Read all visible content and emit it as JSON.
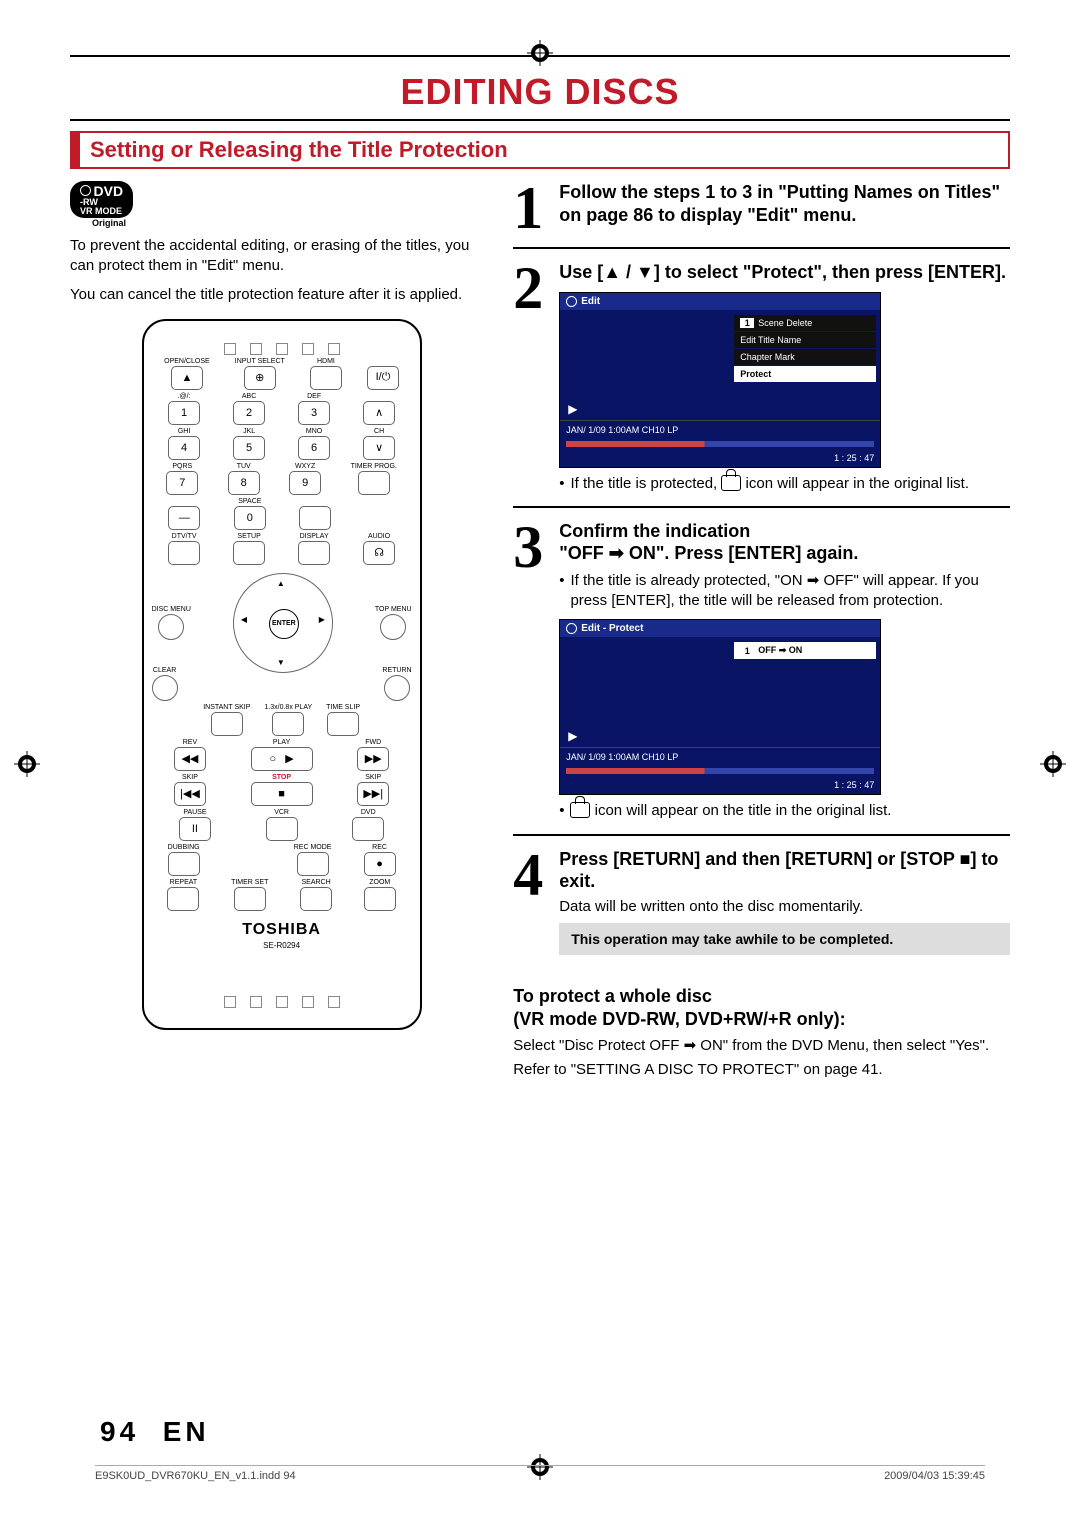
{
  "page": {
    "title": "EDITING DISCS",
    "section": "Setting or Releasing the Title Protection",
    "badge_line1": "DVD",
    "badge_line2": "-RW",
    "badge_line3": "VR MODE",
    "badge_sub": "Original",
    "intro1": "To prevent the accidental editing, or erasing of the titles, you can protect them in \"Edit\" menu.",
    "intro2": "You can cancel the title protection feature after it is applied."
  },
  "remote": {
    "row1": [
      "OPEN/CLOSE",
      "INPUT SELECT",
      "HDMI",
      ""
    ],
    "numpad_labels": [
      ".@/:",
      "ABC",
      "DEF",
      "GHI",
      "JKL",
      "MNO",
      "PQRS",
      "TUV",
      "WXYZ",
      "",
      "SPACE",
      ""
    ],
    "numpad_digits": [
      "1",
      "2",
      "3",
      "4",
      "5",
      "6",
      "7",
      "8",
      "9",
      "—",
      "0",
      ""
    ],
    "ch_label": "CH",
    "timer_label": "TIMER PROG.",
    "row_dtv": [
      "DTV/TV",
      "SETUP",
      "DISPLAY",
      "AUDIO"
    ],
    "disc_menu": "DISC MENU",
    "top_menu": "TOP MENU",
    "enter": "ENTER",
    "clear": "CLEAR",
    "return": "RETURN",
    "row_skip": [
      "INSTANT SKIP",
      "1.3x/0.8x PLAY",
      "TIME SLIP"
    ],
    "row_play": [
      "REV",
      "PLAY",
      "FWD"
    ],
    "row_stop": [
      "SKIP",
      "STOP",
      "SKIP"
    ],
    "row_pause": [
      "PAUSE",
      "VCR",
      "DVD"
    ],
    "row_dub": [
      "DUBBING",
      "",
      "REC MODE",
      "REC"
    ],
    "row_rep": [
      "REPEAT",
      "TIMER SET",
      "SEARCH",
      "ZOOM"
    ],
    "brand": "TOSHIBA",
    "model": "SE-R0294"
  },
  "steps": {
    "s1_h": "Follow the steps 1 to 3 in \"Putting Names on Titles\" on page 86 to display \"Edit\" menu.",
    "s2_h": "Use [▲ / ▼] to select \"Protect\", then press [ENTER].",
    "s2_note": "If the title is protected,  icon will appear in the original list.",
    "s3_h1": "Confirm the indication",
    "s3_h2": "\"OFF ➡ ON\". Press [ENTER] again.",
    "s3_b1": "If the title is already protected, \"ON ➡ OFF\" will appear. If you press [ENTER], the title will be released from protection.",
    "s3_note": " icon will appear on the title in the original list.",
    "s4_h": "Press [RETURN] and then [RETURN] or [STOP ■] to exit.",
    "s4_t": "Data will be written onto the disc momentarily.",
    "s4_box": "This operation may take awhile to be completed."
  },
  "screens": {
    "a_title": "Edit",
    "a_items": [
      "Scene Delete",
      "Edit Title Name",
      "Chapter Mark",
      "Protect"
    ],
    "a_status": "JAN/ 1/09 1:00AM CH10   LP",
    "a_time": "1 : 25 : 47",
    "b_title": "Edit - Protect",
    "b_item": "OFF ➡ ON",
    "b_status": "JAN/ 1/09 1:00AM CH10   LP",
    "b_time": "1 : 25 : 47"
  },
  "whole": {
    "h": "To protect a whole disc\n(VR mode DVD-RW, DVD+RW/+R only):",
    "p1": "Select \"Disc Protect OFF ➡ ON\" from the DVD Menu, then select \"Yes\".",
    "p2": "Refer to \"SETTING A DISC TO PROTECT\" on page 41."
  },
  "footer": {
    "page_num": "94",
    "page_lang": "EN",
    "file": "E9SK0UD_DVR670KU_EN_v1.1.indd   94",
    "date": "2009/04/03   15:39:45"
  }
}
